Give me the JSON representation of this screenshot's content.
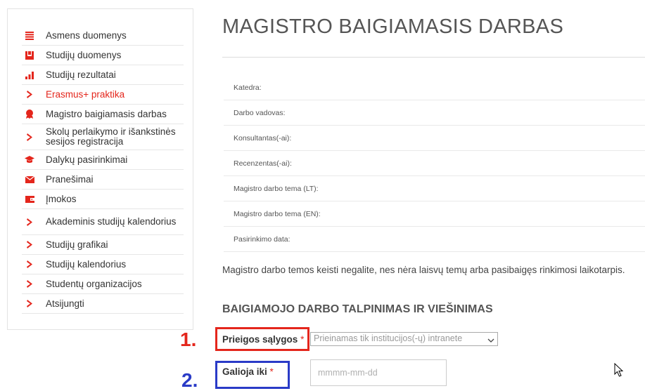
{
  "sidebar": {
    "items": [
      {
        "label": "Asmens duomenys",
        "icon": "list-icon"
      },
      {
        "label": "Studijų duomenys",
        "icon": "book-icon"
      },
      {
        "label": "Studijų rezultatai",
        "icon": "bar-chart-icon"
      },
      {
        "label": "Erasmus+ praktika",
        "icon": "chevron-right-icon",
        "active": true
      },
      {
        "label": "Magistro baigiamasis darbas",
        "icon": "award-icon"
      },
      {
        "label": "Skolų perlaikymo ir išankstinės sesijos registracija",
        "icon": "chevron-right-icon"
      },
      {
        "label": "Dalykų pasirinkimai",
        "icon": "graduation-cap-icon"
      },
      {
        "label": "Pranešimai",
        "icon": "envelope-icon"
      },
      {
        "label": "Įmokos",
        "icon": "wallet-icon"
      },
      {
        "label": "Akademinis studijų kalendorius",
        "icon": "chevron-right-icon"
      },
      {
        "label": "Studijų grafikai",
        "icon": "chevron-right-icon"
      },
      {
        "label": "Studijų kalendorius",
        "icon": "chevron-right-icon"
      },
      {
        "label": "Studentų organizacijos",
        "icon": "chevron-right-icon"
      },
      {
        "label": "Atsijungti",
        "icon": "chevron-right-icon"
      }
    ]
  },
  "main": {
    "title": "MAGISTRO BAIGIAMASIS DARBAS",
    "fields": [
      "Katedra:",
      "Darbo vadovas:",
      "Konsultantas(-ai):",
      "Recenzentas(-ai):",
      "Magistro darbo tema (LT):",
      "Magistro darbo tema (EN):",
      "Pasirinkimo data:"
    ],
    "notice": "Magistro darbo temos keisti negalite, nes nėra laisvų temų arba pasibaigęs rinkimosi laikotarpis.",
    "section_title": "BAIGIAMOJO DARBO TALPINIMAS IR VIEŠINIMAS",
    "access": {
      "label": "Prieigos sąlygos",
      "required_mark": "*",
      "selected": "Prieinamas tik institucijos(-ų) intranete"
    },
    "valid_until": {
      "label": "Galioja iki",
      "required_mark": "*",
      "placeholder": "mmmm-mm-dd",
      "value": ""
    }
  },
  "annotations": {
    "marker1": "1.",
    "marker2": "2."
  },
  "colors": {
    "accent_red": "#e4261c",
    "annotation_blue": "#2a3bc7",
    "text": "#333333"
  }
}
